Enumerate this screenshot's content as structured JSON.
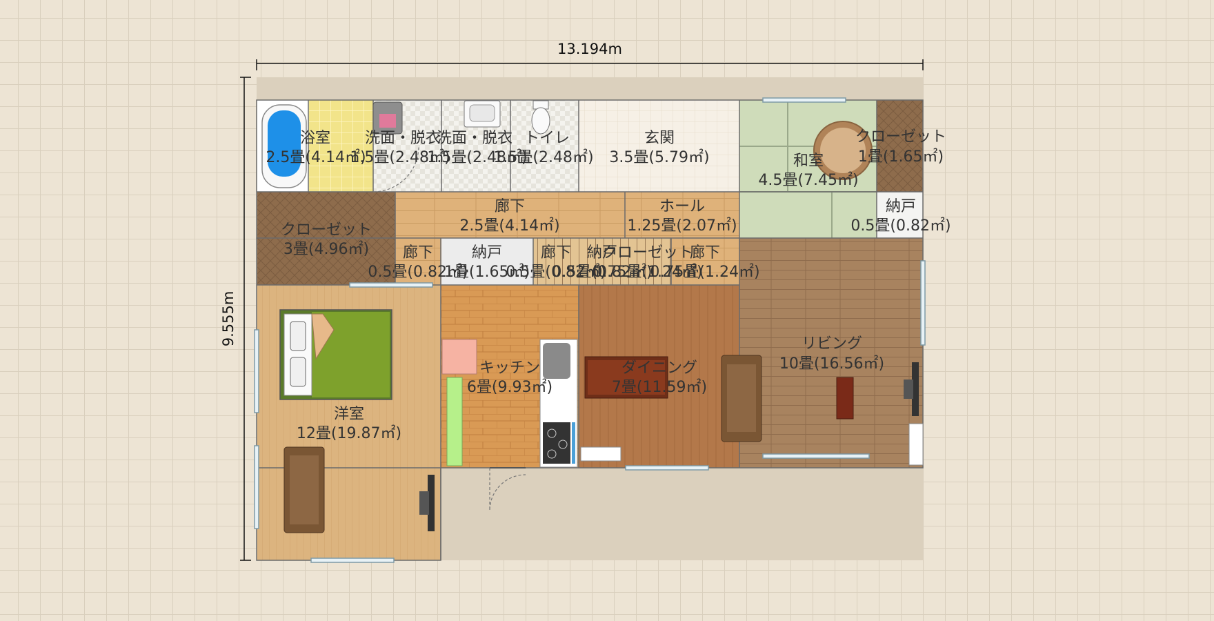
{
  "dimensions": {
    "width": "13.194m",
    "height": "9.555m"
  },
  "rooms": [
    {
      "id": "bath",
      "name": "浴室",
      "size": "2.5畳(4.14㎡)"
    },
    {
      "id": "wash1",
      "name": "洗面・脱衣",
      "size": "1.5畳(2.48㎡)"
    },
    {
      "id": "wash2",
      "name": "洗面・脱衣",
      "size": "1.5畳(2.48㎡)"
    },
    {
      "id": "toilet",
      "name": "トイレ",
      "size": "1.5畳(2.48㎡)"
    },
    {
      "id": "entrance",
      "name": "玄関",
      "size": "3.5畳(5.79㎡)"
    },
    {
      "id": "washitsu",
      "name": "和室",
      "size": "4.5畳(7.45㎡)"
    },
    {
      "id": "closet_tr",
      "name": "クローゼット",
      "size": "1畳(1.65㎡)"
    },
    {
      "id": "nando_r",
      "name": "納戸",
      "size": "0.5畳(0.82㎡)"
    },
    {
      "id": "closet_l",
      "name": "クローゼット",
      "size": "3畳(4.96㎡)"
    },
    {
      "id": "corridor1",
      "name": "廊下",
      "size": "2.5畳(4.14㎡)"
    },
    {
      "id": "hall",
      "name": "ホール",
      "size": "1.25畳(2.07㎡)"
    },
    {
      "id": "corridor2",
      "name": "廊下",
      "size": "0.5畳(0.82㎡)"
    },
    {
      "id": "nando_m",
      "name": "納戸",
      "size": "1畳(1.65㎡)"
    },
    {
      "id": "corridor3",
      "name": "廊下",
      "size": "0.5畳(0.82㎡)"
    },
    {
      "id": "nando_s",
      "name": "納戸",
      "size": "0.5畳(0.82㎡)"
    },
    {
      "id": "closet_m",
      "name": "クローゼット",
      "size": "0.75畳(1.24㎡)"
    },
    {
      "id": "corridor4",
      "name": "廊下",
      "size": "0.75畳(1.24㎡)"
    },
    {
      "id": "yoshitsu",
      "name": "洋室",
      "size": "12畳(19.87㎡)"
    },
    {
      "id": "kitchen",
      "name": "キッチン",
      "size": "6畳(9.93㎡)"
    },
    {
      "id": "dining",
      "name": "ダイニング",
      "size": "7畳(11.59㎡)"
    },
    {
      "id": "living",
      "name": "リビング",
      "size": "10畳(16.56㎡)"
    }
  ],
  "colors": {
    "wood_light": "#ddb47a",
    "wood_brick": "#d49a55",
    "wood_dark": "#b0784a",
    "living_floor": "#a98462",
    "tatami": "#cfdcba",
    "closet": "#8c6a4a",
    "tile": "#f1efe9"
  }
}
